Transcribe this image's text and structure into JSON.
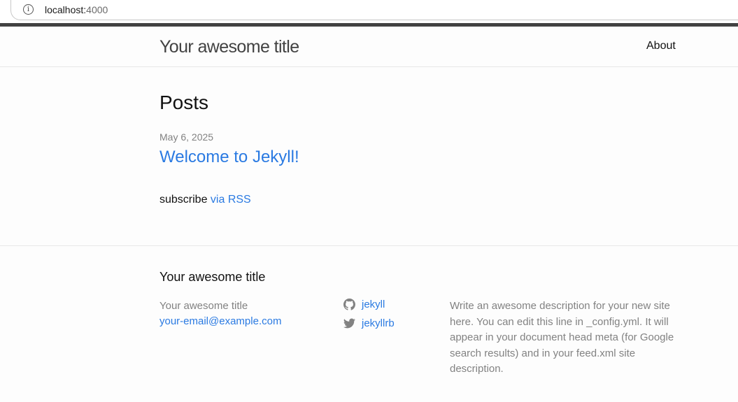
{
  "browser": {
    "url_host": "localhost:",
    "url_port": "4000",
    "info_icon": "info-icon"
  },
  "header": {
    "site_title": "Your awesome title",
    "nav": [
      {
        "label": "About"
      }
    ]
  },
  "main": {
    "heading": "Posts",
    "posts": [
      {
        "date": "May 6, 2025",
        "title": "Welcome to Jekyll!"
      }
    ],
    "subscribe_prefix": "subscribe ",
    "subscribe_link": "via RSS"
  },
  "footer": {
    "heading": "Your awesome title",
    "col1_title": "Your awesome title",
    "email": "your-email@example.com",
    "social": [
      {
        "icon": "github-icon",
        "label": "jekyll"
      },
      {
        "icon": "twitter-icon",
        "label": "jekyllrb"
      }
    ],
    "description": "Write an awesome description for your new site here. You can edit this line in _config.yml. It will appear in your document head meta (for Google search results) and in your feed.xml site description."
  },
  "colors": {
    "link": "#2a7ae2",
    "muted": "#828282",
    "header_border": "#424242"
  }
}
